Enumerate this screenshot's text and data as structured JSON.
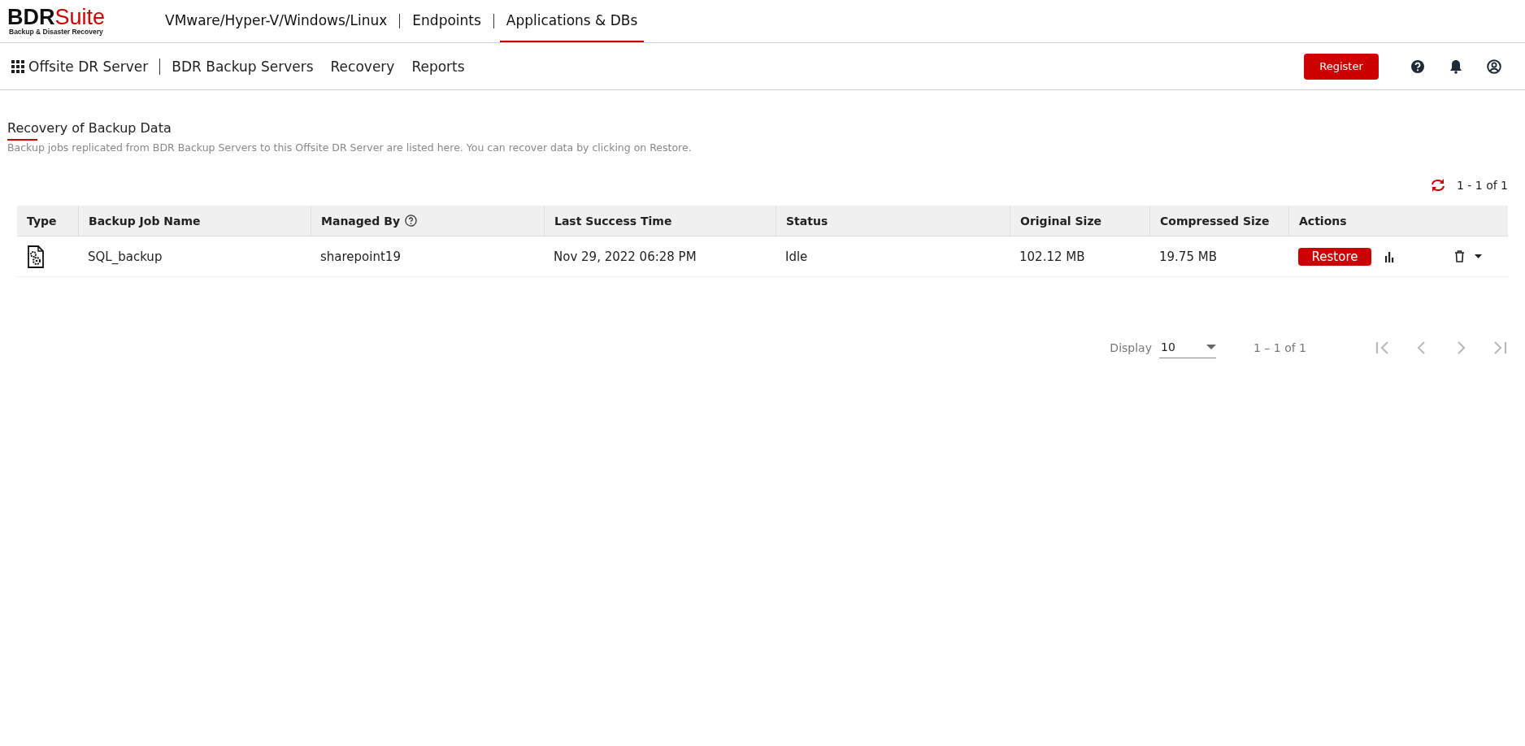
{
  "logo": {
    "brand_dark": "BDR",
    "brand_red": "Suite",
    "tagline": "Backup & Disaster Recovery"
  },
  "top_tabs": [
    {
      "label": "VMware/Hyper-V/Windows/Linux",
      "selected": false
    },
    {
      "label": "Endpoints",
      "selected": false
    },
    {
      "label": "Applications & DBs",
      "selected": true
    }
  ],
  "nav": {
    "title": "Offsite DR Server",
    "items": [
      "BDR Backup Servers",
      "Recovery",
      "Reports"
    ],
    "register": "Register"
  },
  "page": {
    "title": "Recovery of Backup Data",
    "description": "Backup jobs replicated from BDR Backup Servers to this Offsite DR Server are listed here. You can recover data by clicking on Restore.",
    "count": "1 - 1 of 1"
  },
  "table": {
    "columns": [
      "Type",
      "Backup Job Name",
      "Managed By",
      "Last Success Time",
      "Status",
      "Original Size",
      "Compressed Size",
      "Actions"
    ],
    "rows": [
      {
        "name": "SQL_backup",
        "managed_by": "sharepoint19",
        "last_success": "Nov 29, 2022 06:28 PM",
        "status": "Idle",
        "original_size": "102.12 MB",
        "compressed_size": "19.75 MB",
        "action": "Restore"
      }
    ]
  },
  "pagination": {
    "display_label": "Display",
    "page_size": "10",
    "range": "1 – 1 of 1"
  }
}
